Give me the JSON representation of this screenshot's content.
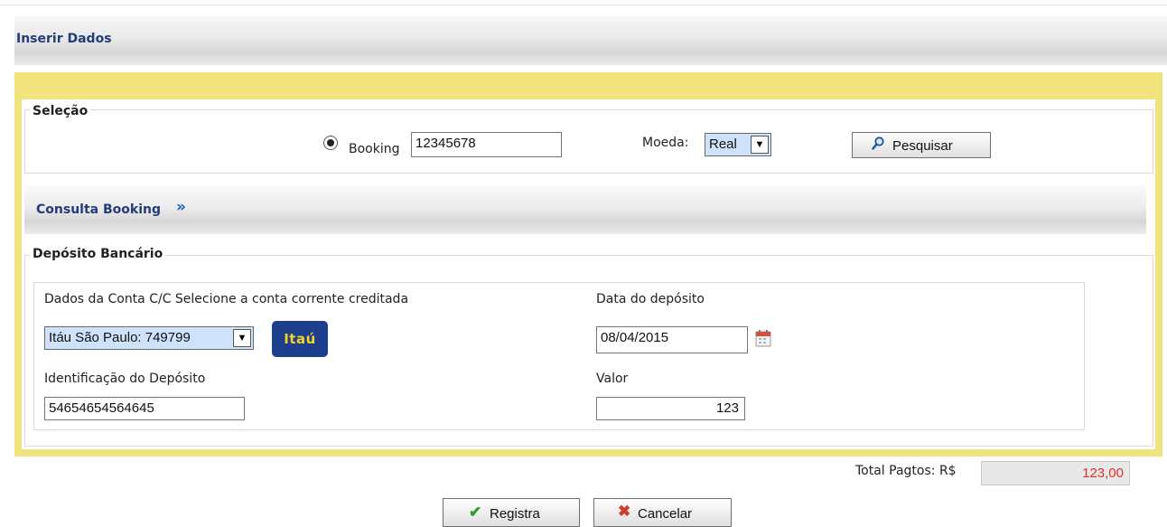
{
  "header": {
    "title": "Inserir Dados"
  },
  "selecao": {
    "legend": "Seleção",
    "booking_label": "Booking",
    "booking_value": "12345678",
    "moeda_label": "Moeda:",
    "moeda_value": "Real",
    "pesquisar_label": "Pesquisar"
  },
  "consulta": {
    "label": "Consulta Booking",
    "arrows": "»"
  },
  "deposito": {
    "legend": "Depósito Bancário",
    "conta_label": "Dados da Conta C/C Selecione a conta corrente creditada",
    "conta_value": "Itáu São Paulo: 749799",
    "bank_logo_text": "Itaú",
    "data_label": "Data do depósito",
    "data_value": "08/04/2015",
    "ident_label": "Identificação do Depósito",
    "ident_value": "54654654564645",
    "valor_label": "Valor",
    "valor_value": "123"
  },
  "total": {
    "label": "Total Pagtos: R$",
    "value": "123,00"
  },
  "actions": {
    "registra_label": "Registra",
    "cancelar_label": "Cancelar"
  },
  "icons": {
    "radio": "radio-selected-icon",
    "search": "magnifier-icon",
    "calendar": "calendar-icon",
    "check": "check-icon",
    "cancel": "x-icon"
  },
  "colors": {
    "frame_yellow": "#f1e37e",
    "link_blue": "#233c7a",
    "total_red": "#e03030",
    "bank_blue": "#1c3e8c",
    "bank_yellow": "#f4d326"
  }
}
